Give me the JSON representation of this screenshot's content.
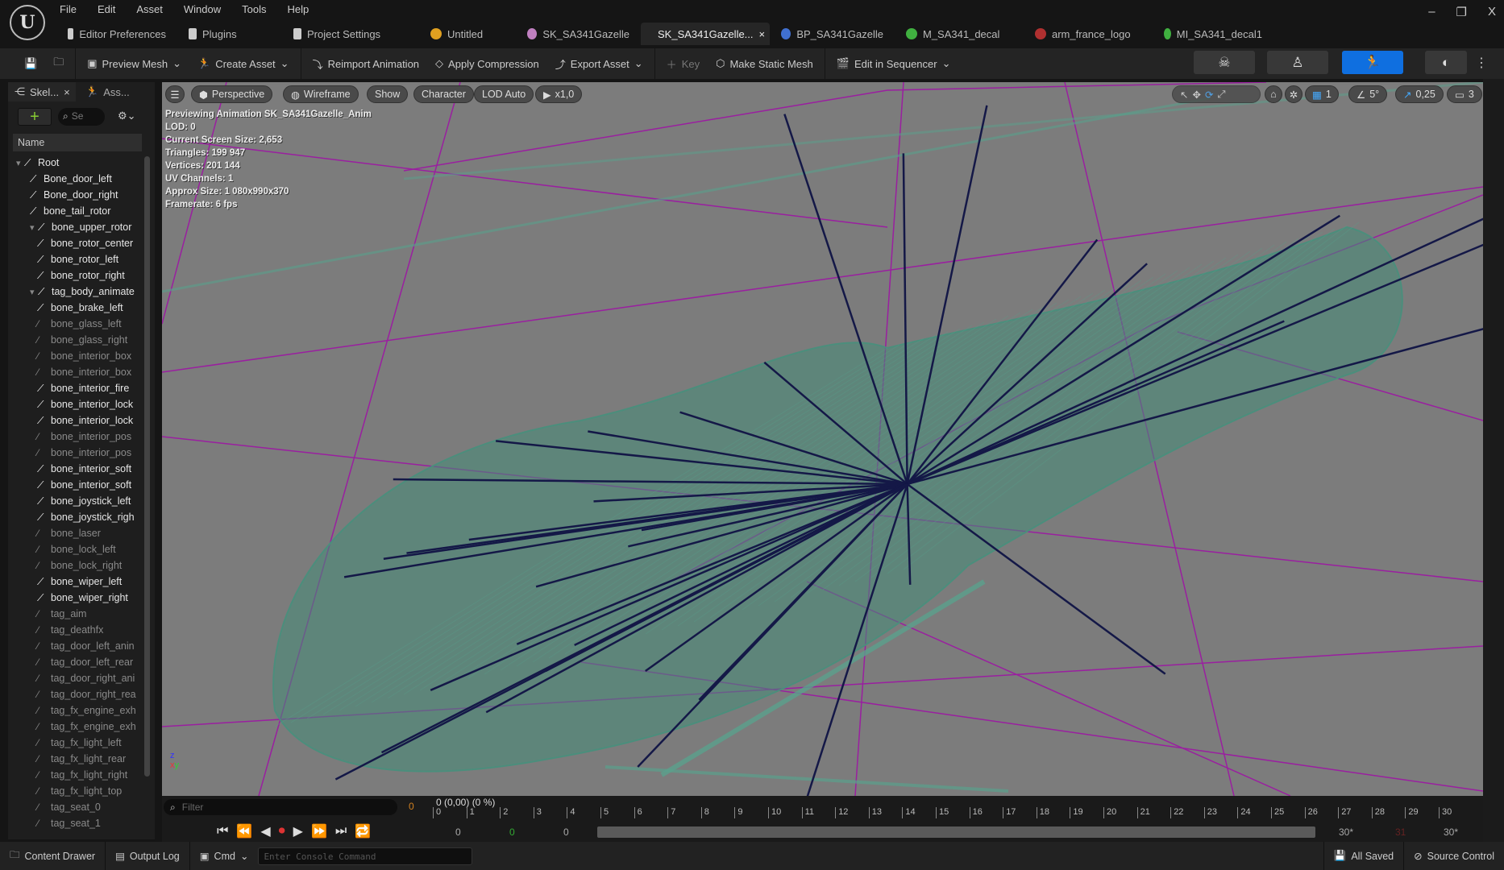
{
  "menu": [
    "File",
    "Edit",
    "Asset",
    "Window",
    "Tools",
    "Help"
  ],
  "tabs": [
    {
      "label": "Editor Preferences",
      "icon": "sliders-icon",
      "color": "#cccccc"
    },
    {
      "label": "Plugins",
      "icon": "plug-icon",
      "color": "#cccccc"
    },
    {
      "label": "Project Settings",
      "icon": "settings-gear-icon",
      "color": "#cccccc"
    },
    {
      "label": "Untitled",
      "icon": "level-icon",
      "color": "#e0a020"
    },
    {
      "label": "SK_SA341Gazelle",
      "icon": "skeletal-mesh-icon",
      "color": "#c080c0"
    },
    {
      "label": "SK_SA341Gazelle...",
      "icon": "animation-icon",
      "color": "#70c070",
      "active": true,
      "close": "×"
    },
    {
      "label": "BP_SA341Gazelle",
      "icon": "blueprint-icon",
      "color": "#4070d0"
    },
    {
      "label": "M_SA341_decal",
      "icon": "material-icon",
      "color": "#40b040"
    },
    {
      "label": "arm_france_logo",
      "icon": "texture-icon",
      "color": "#b03030"
    },
    {
      "label": "MI_SA341_decal1",
      "icon": "material-instance-icon",
      "color": "#40b040"
    }
  ],
  "window_controls": {
    "minimize": "–",
    "restore": "❐",
    "close": "X"
  },
  "toolbar": {
    "preview_mesh": "Preview Mesh",
    "create_asset": "Create Asset",
    "reimport": "Reimport Animation",
    "apply_compression": "Apply Compression",
    "export_asset": "Export Asset",
    "key": "Key",
    "make_static_mesh": "Make Static Mesh",
    "edit_in_sequencer": "Edit in Sequencer",
    "dropdown": "⌄"
  },
  "left_panel": {
    "tab_skeleton": "Skel...",
    "tab_close": "×",
    "tab_asset": "Ass...",
    "search_placeholder": "Se",
    "column_name": "Name",
    "bones": [
      {
        "name": "Root",
        "depth": 0,
        "bright": true,
        "expanded": true
      },
      {
        "name": "Bone_door_left",
        "depth": 1,
        "bright": true
      },
      {
        "name": "Bone_door_right",
        "depth": 1,
        "bright": true
      },
      {
        "name": "bone_tail_rotor",
        "depth": 1,
        "bright": true
      },
      {
        "name": "bone_upper_rotor",
        "depth": 1,
        "bright": true,
        "expanded": true
      },
      {
        "name": "bone_rotor_center",
        "depth": 2,
        "bright": true
      },
      {
        "name": "bone_rotor_left",
        "depth": 2,
        "bright": true
      },
      {
        "name": "bone_rotor_right",
        "depth": 2,
        "bright": true
      },
      {
        "name": "tag_body_animate",
        "depth": 1,
        "bright": true,
        "expanded": true
      },
      {
        "name": "bone_brake_left",
        "depth": 2,
        "bright": true
      },
      {
        "name": "bone_glass_left",
        "depth": 2,
        "bright": false
      },
      {
        "name": "bone_glass_right",
        "depth": 2,
        "bright": false
      },
      {
        "name": "bone_interior_box",
        "depth": 2,
        "bright": false
      },
      {
        "name": "bone_interior_box",
        "depth": 2,
        "bright": false
      },
      {
        "name": "bone_interior_fire",
        "depth": 2,
        "bright": true
      },
      {
        "name": "bone_interior_lock",
        "depth": 2,
        "bright": true
      },
      {
        "name": "bone_interior_lock",
        "depth": 2,
        "bright": true
      },
      {
        "name": "bone_interior_pos",
        "depth": 2,
        "bright": false
      },
      {
        "name": "bone_interior_pos",
        "depth": 2,
        "bright": false
      },
      {
        "name": "bone_interior_soft",
        "depth": 2,
        "bright": true
      },
      {
        "name": "bone_interior_soft",
        "depth": 2,
        "bright": true
      },
      {
        "name": "bone_joystick_left",
        "depth": 2,
        "bright": true
      },
      {
        "name": "bone_joystick_righ",
        "depth": 2,
        "bright": true
      },
      {
        "name": "bone_laser",
        "depth": 2,
        "bright": false
      },
      {
        "name": "bone_lock_left",
        "depth": 2,
        "bright": false
      },
      {
        "name": "bone_lock_right",
        "depth": 2,
        "bright": false
      },
      {
        "name": "bone_wiper_left",
        "depth": 2,
        "bright": true
      },
      {
        "name": "bone_wiper_right",
        "depth": 2,
        "bright": true
      },
      {
        "name": "tag_aim",
        "depth": 2,
        "bright": false
      },
      {
        "name": "tag_deathfx",
        "depth": 2,
        "bright": false
      },
      {
        "name": "tag_door_left_anin",
        "depth": 2,
        "bright": false
      },
      {
        "name": "tag_door_left_rear",
        "depth": 2,
        "bright": false
      },
      {
        "name": "tag_door_right_ani",
        "depth": 2,
        "bright": false
      },
      {
        "name": "tag_door_right_rea",
        "depth": 2,
        "bright": false
      },
      {
        "name": "tag_fx_engine_exh",
        "depth": 2,
        "bright": false
      },
      {
        "name": "tag_fx_engine_exh",
        "depth": 2,
        "bright": false
      },
      {
        "name": "tag_fx_light_left",
        "depth": 2,
        "bright": false
      },
      {
        "name": "tag_fx_light_rear",
        "depth": 2,
        "bright": false
      },
      {
        "name": "tag_fx_light_right",
        "depth": 2,
        "bright": false
      },
      {
        "name": "tag_fx_light_top",
        "depth": 2,
        "bright": false
      },
      {
        "name": "tag_seat_0",
        "depth": 2,
        "bright": false
      },
      {
        "name": "tag_seat_1",
        "depth": 2,
        "bright": false
      }
    ]
  },
  "viewport": {
    "perspective": "Perspective",
    "wireframe": "Wireframe",
    "show": "Show",
    "character": "Character",
    "lod": "LOD Auto",
    "speed": "x1,0",
    "grid_value": "1",
    "angle_snap": "5°",
    "scale_snap": "0,25",
    "camera_speed": "3",
    "stats": [
      "Previewing Animation SK_SA341Gazelle_Anim",
      "LOD: 0",
      "Current Screen Size: 2,653",
      "Triangles: 199 947",
      "Vertices: 201 144",
      "UV Channels: 1",
      "Approx Size: 1 080x990x370",
      "Framerate: 6 fps"
    ]
  },
  "timeline": {
    "filter_placeholder": "Filter",
    "filter_count": "0",
    "current": "0 (0,00) (0 %)",
    "ticks": [
      "0",
      "1",
      "2",
      "3",
      "4",
      "5",
      "6",
      "7",
      "8",
      "9",
      "10",
      "11",
      "12",
      "13",
      "14",
      "15",
      "16",
      "17",
      "18",
      "19",
      "20",
      "21",
      "22",
      "23",
      "24",
      "25",
      "26",
      "27",
      "28",
      "29",
      "30"
    ],
    "start": "0",
    "start_green": "0",
    "view_start": "0",
    "end": "30*",
    "end_red": "31",
    "view_end": "30*"
  },
  "status": {
    "content_drawer": "Content Drawer",
    "output_log": "Output Log",
    "cmd": "Cmd",
    "console_placeholder": "Enter Console Command",
    "all_saved": "All Saved",
    "source_control": "Source Control"
  }
}
